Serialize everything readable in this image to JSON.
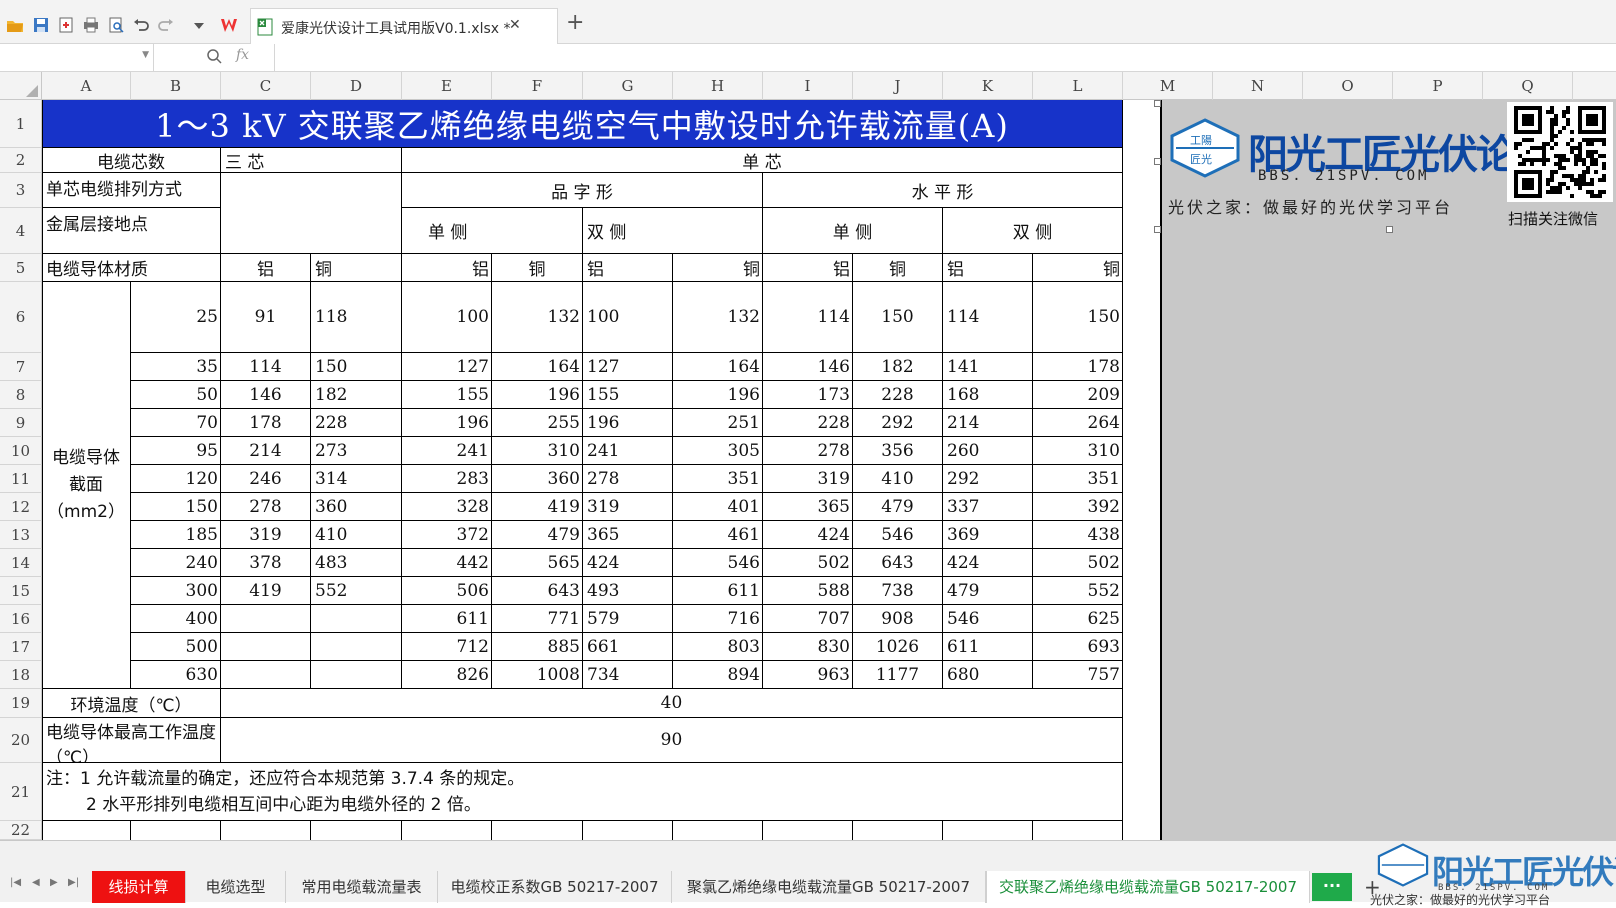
{
  "app": {
    "doc_tab_name": "爱康光伏设计工具试用版V0.1.xlsx *",
    "fx_label": "fx"
  },
  "columns": [
    "A",
    "B",
    "C",
    "D",
    "E",
    "F",
    "G",
    "H",
    "I",
    "J",
    "K",
    "L",
    "M",
    "N",
    "O",
    "P",
    "Q"
  ],
  "rows": [
    "1",
    "2",
    "3",
    "4",
    "5",
    "6",
    "7",
    "8",
    "9",
    "10",
    "11",
    "12",
    "13",
    "14",
    "15",
    "16",
    "17",
    "18",
    "19",
    "20",
    "21",
    "22"
  ],
  "sheet": {
    "title": "1～3 kV 交联聚乙烯绝缘电缆空气中敷设时允许载流量(A)",
    "label_cores": "电缆芯数",
    "three_core": "三 芯",
    "single_core": "单 芯",
    "label_arrangement": "单芯电缆排列方式",
    "trefoil": "品 字 形",
    "horizontal": "水 平 形",
    "label_grounding": "金属层接地点",
    "single_side": "单 侧",
    "double_side": "双 侧",
    "label_material": "电缆导体材质",
    "al": "铝",
    "cu": "铜",
    "section_label": [
      "电缆导体",
      "截面",
      "（mm2）"
    ],
    "label_ambient": "环境温度（℃）",
    "ambient_value": "40",
    "label_max_temp": "电缆导体最高工作温度（℃）",
    "max_temp_value": "90",
    "note_1": "注：1 允许载流量的确定，还应符合本规范第 3.7.4 条的规定。",
    "note_2": "2 水平形排列电缆相互间中心距为电缆外径的 2 倍。",
    "data_rows": [
      [
        "25",
        "91",
        "118",
        "100",
        "132",
        "100",
        "132",
        "114",
        "150",
        "114",
        "150"
      ],
      [
        "35",
        "114",
        "150",
        "127",
        "164",
        "127",
        "164",
        "146",
        "182",
        "141",
        "178"
      ],
      [
        "50",
        "146",
        "182",
        "155",
        "196",
        "155",
        "196",
        "173",
        "228",
        "168",
        "209"
      ],
      [
        "70",
        "178",
        "228",
        "196",
        "255",
        "196",
        "251",
        "228",
        "292",
        "214",
        "264"
      ],
      [
        "95",
        "214",
        "273",
        "241",
        "310",
        "241",
        "305",
        "278",
        "356",
        "260",
        "310"
      ],
      [
        "120",
        "246",
        "314",
        "283",
        "360",
        "278",
        "351",
        "319",
        "410",
        "292",
        "351"
      ],
      [
        "150",
        "278",
        "360",
        "328",
        "419",
        "319",
        "401",
        "365",
        "479",
        "337",
        "392"
      ],
      [
        "185",
        "319",
        "410",
        "372",
        "479",
        "365",
        "461",
        "424",
        "546",
        "369",
        "438"
      ],
      [
        "240",
        "378",
        "483",
        "442",
        "565",
        "424",
        "546",
        "502",
        "643",
        "424",
        "502"
      ],
      [
        "300",
        "419",
        "552",
        "506",
        "643",
        "493",
        "611",
        "588",
        "738",
        "479",
        "552"
      ],
      [
        "400",
        "",
        "",
        "611",
        "771",
        "579",
        "716",
        "707",
        "908",
        "546",
        "625"
      ],
      [
        "500",
        "",
        "",
        "712",
        "885",
        "661",
        "803",
        "830",
        "1026",
        "611",
        "693"
      ],
      [
        "630",
        "",
        "",
        "826",
        "1008",
        "734",
        "894",
        "963",
        "1177",
        "680",
        "757"
      ]
    ]
  },
  "logo": {
    "name": "阳光工匠光伏论坛",
    "url": "BBS. 21SPV. COM",
    "slogan": "光伏之家：做最好的光伏学习平台",
    "badge": "工陽匠光",
    "qr_caption": "扫描关注微信"
  },
  "tabs": [
    {
      "label": "线损计算",
      "style": "red"
    },
    {
      "label": "电缆选型",
      "style": ""
    },
    {
      "label": "常用电缆载流量表",
      "style": ""
    },
    {
      "label": "电缆校正系数GB 50217-2007",
      "style": ""
    },
    {
      "label": "聚氯乙烯绝缘电缆载流量GB 50217-2007",
      "style": ""
    },
    {
      "label": "交联聚乙烯绝缘电缆载流量GB 50217-2007",
      "style": "active"
    }
  ],
  "more_tabs_label": "···",
  "watermark": {
    "name": "阳光工匠光伏论坛",
    "url": "BBS. 21SPV. COM",
    "slogan": "光伏之家：做最好的光伏学习平台"
  },
  "colors": {
    "title_bg": "#1733c9",
    "active_tab": "#1a8f3a",
    "red_tab": "#ee1111"
  }
}
